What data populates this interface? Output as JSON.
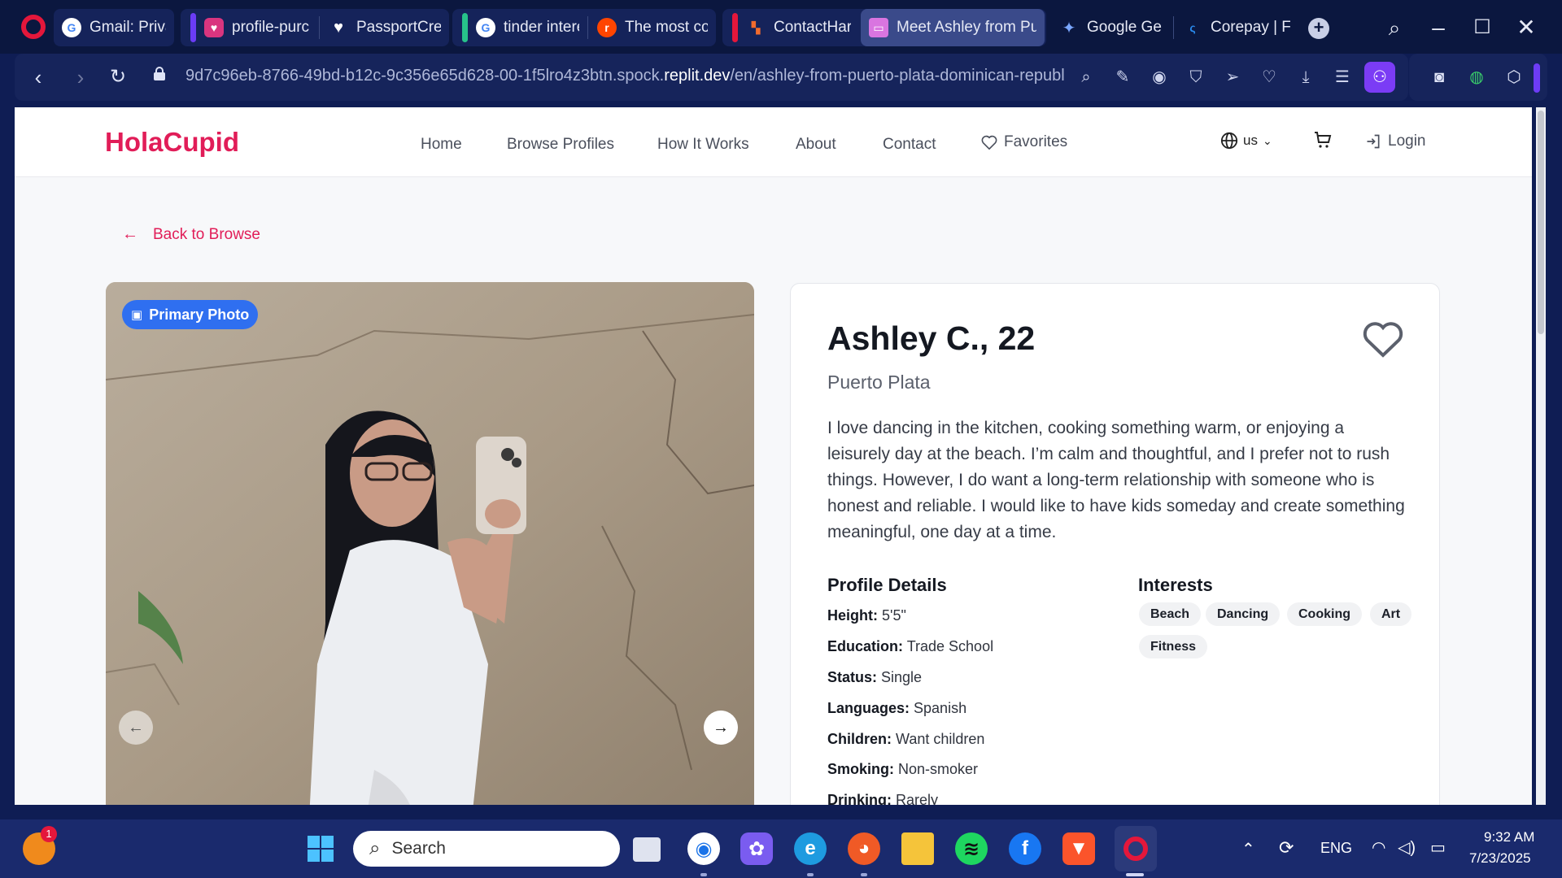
{
  "browser": {
    "tabs": [
      {
        "label": "Gmail: Private",
        "icon": "google-icon"
      },
      {
        "label": "profile-purch",
        "icon": "lovable-icon"
      },
      {
        "label": "PassportCrew",
        "icon": "heart-icon"
      },
      {
        "label": "tinder interes",
        "icon": "google-icon"
      },
      {
        "label": "The most con",
        "icon": "reddit-icon"
      },
      {
        "label": "ContactHarve",
        "icon": "app-icon"
      },
      {
        "label": "Meet Ashley from Puer",
        "icon": "site-icon",
        "active": true
      },
      {
        "label": "Google Gemi",
        "icon": "gemini-icon"
      },
      {
        "label": "Corepay | Ful",
        "icon": "corepay-icon"
      }
    ],
    "url_prefix": "9d7c96eb-8766-49bd-b12c-9c356e65d628-00-1f5lro4z3btn.spock.",
    "url_domain": "replit.dev",
    "url_path": "/en/ashley-from-puerto-plata-dominican-republ"
  },
  "site": {
    "brand": "HolaCupid",
    "nav": [
      "Home",
      "Browse Profiles",
      "How It Works",
      "About",
      "Contact"
    ],
    "favorites": "Favorites",
    "language": "us",
    "login": "Login",
    "back": "Back to Browse"
  },
  "photo": {
    "badge": "Primary Photo"
  },
  "profile": {
    "name": "Ashley C., 22",
    "location": "Puerto Plata",
    "bio": "I love dancing in the kitchen, cooking something warm, or enjoying a leisurely day at the beach. I’m calm and thoughtful, and I prefer not to rush things. However, I do want a long-term relationship with someone who is honest and reliable. I would like to have kids someday and create something meaningful, one day at a time.",
    "details_title": "Profile Details",
    "details": [
      {
        "label": "Height:",
        "value": "5'5\""
      },
      {
        "label": "Education:",
        "value": "Trade School"
      },
      {
        "label": "Status:",
        "value": "Single"
      },
      {
        "label": "Languages:",
        "value": "Spanish"
      },
      {
        "label": "Children:",
        "value": "Want children"
      },
      {
        "label": "Smoking:",
        "value": "Non-smoker"
      },
      {
        "label": "Drinking:",
        "value": "Rarely"
      }
    ],
    "interests_title": "Interests",
    "interests": [
      "Beach",
      "Dancing",
      "Cooking",
      "Art",
      "Fitness"
    ]
  },
  "taskbar": {
    "search_placeholder": "Search",
    "language": "ENG",
    "time": "9:32 AM",
    "date": "7/23/2025",
    "notification_count": "1"
  }
}
